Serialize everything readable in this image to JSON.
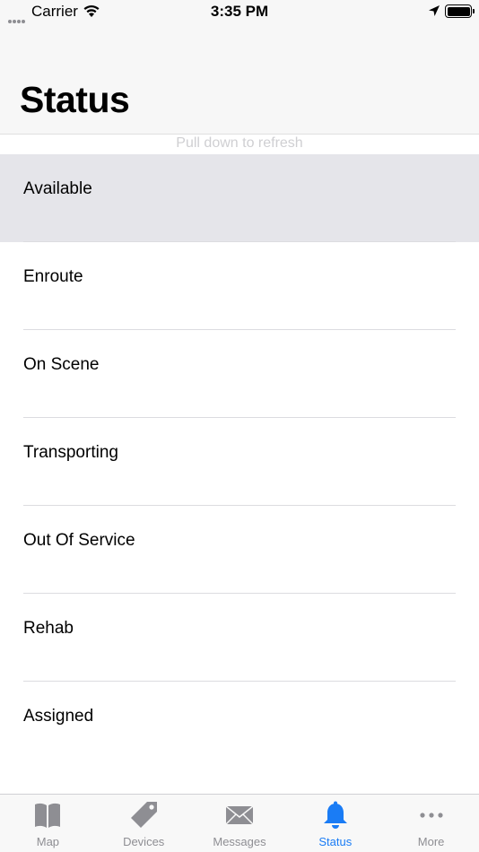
{
  "status_bar": {
    "carrier": "Carrier",
    "time": "3:35 PM",
    "icons": [
      "signal-dots-icon",
      "wifi-icon",
      "location-arrow-icon",
      "battery-icon"
    ]
  },
  "header": {
    "title": "Status"
  },
  "refresh_hint": "Pull down to refresh",
  "statuses": [
    {
      "label": "Available",
      "selected": true
    },
    {
      "label": "Enroute",
      "selected": false
    },
    {
      "label": "On Scene",
      "selected": false
    },
    {
      "label": "Transporting",
      "selected": false
    },
    {
      "label": "Out Of Service",
      "selected": false
    },
    {
      "label": "Rehab",
      "selected": false
    },
    {
      "label": "Assigned",
      "selected": false
    }
  ],
  "tab_bar": {
    "active_color": "#1a7cf5",
    "inactive_color": "#8e8e93",
    "tabs": [
      {
        "label": "Map",
        "icon": "book-map-icon",
        "active": false
      },
      {
        "label": "Devices",
        "icon": "tag-icon",
        "active": false
      },
      {
        "label": "Messages",
        "icon": "envelope-icon",
        "active": false
      },
      {
        "label": "Status",
        "icon": "bell-icon",
        "active": true
      },
      {
        "label": "More",
        "icon": "more-dots-icon",
        "active": false
      }
    ]
  }
}
